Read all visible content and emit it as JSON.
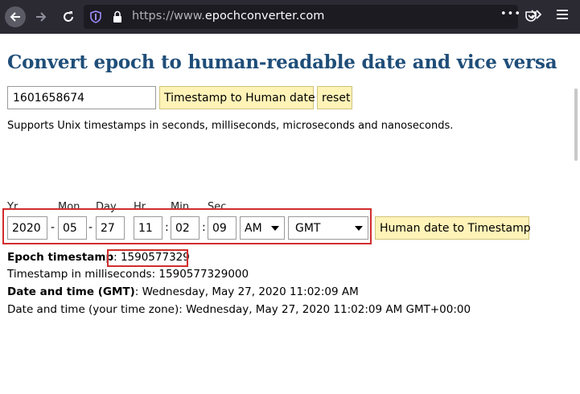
{
  "browser": {
    "url_prefix": "https://www.",
    "url_domain": "epochconverter.com",
    "more_dots": "•••"
  },
  "page": {
    "title": "Convert epoch to human-readable date and vice versa",
    "epoch_input_value": "1601658674",
    "btn_timestamp_to_human": "Timestamp to Human date",
    "btn_reset": "reset",
    "supports_text": "Supports Unix timestamps in seconds, milliseconds, microseconds and nanoseconds."
  },
  "date_form": {
    "labels": {
      "yr": "Yr",
      "mon": "Mon",
      "day": "Day",
      "hr": "Hr",
      "min": "Min",
      "sec": "Sec"
    },
    "values": {
      "yr": "2020",
      "mon": "05",
      "day": "27",
      "hr": "11",
      "min": "02",
      "sec": "09",
      "ampm": "AM",
      "tz": "GMT"
    },
    "sep_dash": "-",
    "sep_colon": ":",
    "btn_human_to_timestamp": "Human date to Timestamp"
  },
  "results": {
    "epoch_label": "Epoch timestamp",
    "epoch_value": "1590577329",
    "ms_label": "Timestamp in milliseconds: ",
    "ms_value": "1590577329000",
    "gmt_label": "Date and time (GMT)",
    "gmt_value": ": Wednesday, May 27, 2020 11:02:09 AM",
    "local_label": "Date and time (your time zone): ",
    "local_value": "Wednesday, May 27, 2020 11:02:09 AM GMT+00:00"
  },
  "colors": {
    "title": "#1f4e79",
    "button_bg": "#fff3b8",
    "highlight_border": "#d12d2d",
    "toolbar_bg": "#2b2a33"
  }
}
